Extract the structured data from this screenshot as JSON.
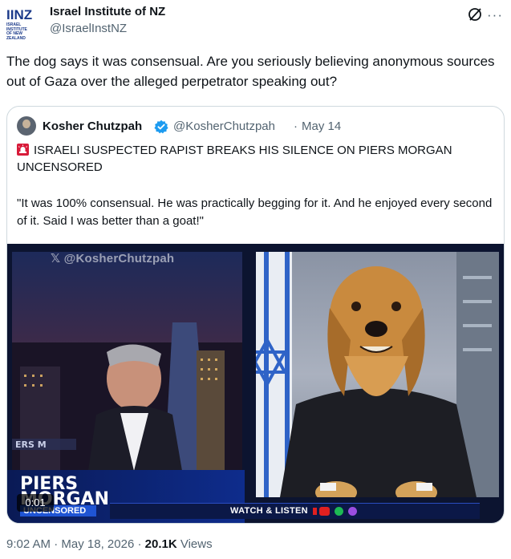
{
  "author": {
    "logo_text": "IINZ",
    "logo_subtext": "ISRAEL INSTITUTE\nOF NEW ZEALAND",
    "name": "Israel Institute of NZ",
    "handle": "@IsraelInstNZ",
    "more_label": "···"
  },
  "tweet": {
    "text": "The dog says it was consensual. Are you seriously believing anonymous sources out of Gaza over the alleged perpetrator speaking out?"
  },
  "quoted": {
    "name": "Kosher Chutzpah",
    "handle": "@KosherChutzpah",
    "separator": "·",
    "date": "May 14",
    "headline": "ISRAELI SUSPECTED RAPIST BREAKS HIS SILENCE ON PIERS MORGAN UNCENSORED",
    "quote": "\"It was 100% consensual. He was practically begging for it. And he enjoyed every second of it. Said I was better than a goat!\""
  },
  "video": {
    "watermark": "@KosherChutzpah",
    "brand_line1": "PIERS",
    "brand_line2": "MORGAN",
    "brand_tag": "UNCENSORED",
    "ticker": "WATCH & LISTEN",
    "elapsed": "0:01",
    "side_label": "ERS M"
  },
  "footer": {
    "time": "9:02 AM",
    "separator": "·",
    "date": "May 18, 2026",
    "views_count": "20.1K",
    "views_label": "Views"
  },
  "colors": {
    "text": "#0f1419",
    "secondary": "#536471",
    "border": "#cfd9de",
    "verified": "#1d9bf0",
    "logo_blue": "#1b3a8a"
  }
}
